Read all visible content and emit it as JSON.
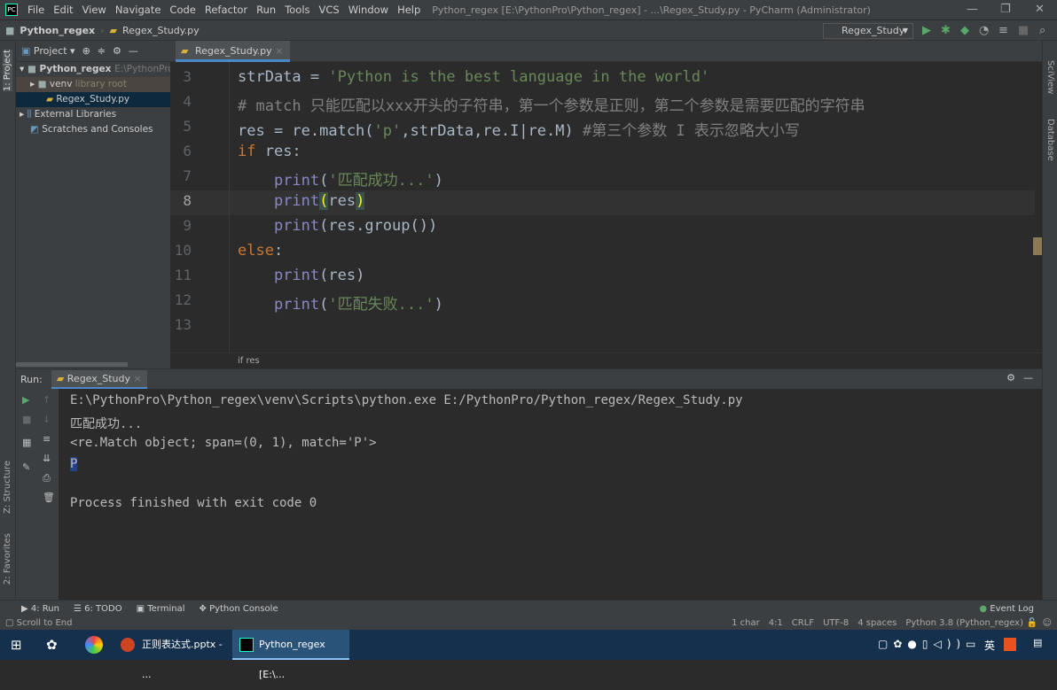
{
  "menu": {
    "items": [
      "File",
      "Edit",
      "View",
      "Navigate",
      "Code",
      "Refactor",
      "Run",
      "Tools",
      "VCS",
      "Window",
      "Help"
    ],
    "title": "Python_regex [E:\\PythonPro\\Python_regex] - ...\\Regex_Study.py - PyCharm (Administrator)"
  },
  "nav": {
    "project": "Python_regex",
    "file": "Regex_Study.py",
    "run_config": "Regex_Study"
  },
  "left_strip": {
    "project": "1: Project",
    "structure": "Z: Structure",
    "favorites": "2: Favorites"
  },
  "right_strip": {
    "sciview": "SciView",
    "database": "Database"
  },
  "project": {
    "header": "Project",
    "tree": [
      {
        "label": "Python_regex",
        "hint": "E:\\PythonPro\\Python_regex"
      },
      {
        "label": "venv",
        "hint": "library root"
      },
      {
        "label": "Regex_Study.py",
        "hint": ""
      },
      {
        "label": "External Libraries",
        "hint": ""
      },
      {
        "label": "Scratches and Consoles",
        "hint": ""
      }
    ]
  },
  "editor": {
    "tab": "Regex_Study.py",
    "breadcrumb": "if res",
    "lines": [
      {
        "n": "3",
        "t": [
          [
            "",
            "strData = "
          ],
          [
            "str",
            "'Python is the best language in the world'"
          ]
        ]
      },
      {
        "n": "4",
        "t": [
          [
            "cm",
            "# match 只能匹配以xxx开头的子符串，第一个参数是正则，第二个参数是需要匹配的字符串"
          ]
        ]
      },
      {
        "n": "5",
        "t": [
          [
            "",
            "res = re.match("
          ],
          [
            "str",
            "'p'"
          ],
          [
            "",
            ",strData,re.I|re.M) "
          ],
          [
            "cm",
            "#第三个参数 I 表示忽略大小写"
          ]
        ]
      },
      {
        "n": "6",
        "t": [
          [
            "kw",
            "if"
          ],
          [
            "",
            " res:"
          ]
        ]
      },
      {
        "n": "7",
        "t": [
          [
            "",
            "    "
          ],
          [
            "fn",
            "print"
          ],
          [
            "",
            "("
          ],
          [
            "str",
            "'匹配成功...'"
          ],
          [
            "",
            ")"
          ]
        ]
      },
      {
        "n": "8",
        "t": [
          [
            "",
            "    "
          ],
          [
            "fn",
            "print"
          ],
          [
            "hl",
            "("
          ],
          [
            "",
            "res"
          ],
          [
            "hl",
            ")"
          ]
        ]
      },
      {
        "n": "9",
        "t": [
          [
            "",
            "    "
          ],
          [
            "fn",
            "print"
          ],
          [
            "",
            "(res.group())"
          ]
        ]
      },
      {
        "n": "10",
        "t": [
          [
            "kw",
            "else"
          ],
          [
            "",
            ":"
          ]
        ]
      },
      {
        "n": "11",
        "t": [
          [
            "",
            "    "
          ],
          [
            "fn",
            "print"
          ],
          [
            "",
            "(res)"
          ]
        ]
      },
      {
        "n": "12",
        "t": [
          [
            "",
            "    "
          ],
          [
            "fn",
            "print"
          ],
          [
            "",
            "("
          ],
          [
            "str",
            "'匹配失败...'"
          ],
          [
            "",
            ")"
          ]
        ]
      },
      {
        "n": "13",
        "t": []
      }
    ]
  },
  "run": {
    "label": "Run:",
    "tab": "Regex_Study",
    "output": [
      "E:\\PythonPro\\Python_regex\\venv\\Scripts\\python.exe E:/PythonPro/Python_regex/Regex_Study.py",
      "匹配成功...",
      "<re.Match object; span=(0, 1), match='P'>",
      "P",
      "",
      "Process finished with exit code 0"
    ]
  },
  "bottom_tabs": [
    "4: Run",
    "6: TODO",
    "Terminal",
    "Python Console"
  ],
  "event_log": "Event Log",
  "status": {
    "left": "Scroll to End",
    "items": [
      "1 char",
      "4:1",
      "CRLF",
      "UTF-8",
      "4 spaces",
      "Python 3.8 (Python_regex)"
    ]
  },
  "taskbar": {
    "ppt": "正则表达式.pptx - ...",
    "pycharm": "Python_regex [E:\\...",
    "ime": "英"
  }
}
